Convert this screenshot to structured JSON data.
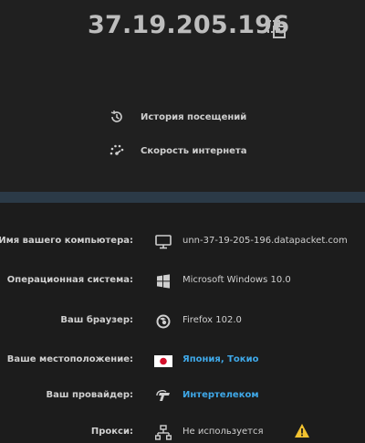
{
  "ip": {
    "address": "37.19.205.196",
    "copy_icon": "copy-icon"
  },
  "links": [
    {
      "label": "История посещений",
      "icon": "history-icon"
    },
    {
      "label": "Скорость интернета",
      "icon": "speedometer-icon"
    }
  ],
  "info": {
    "computer_name": {
      "label": "Имя вашего компьютера:",
      "value": "unn-37-19-205-196.datapacket.com",
      "icon": "monitor-icon"
    },
    "os": {
      "label": "Операционная система:",
      "value": "Microsoft Windows 10.0",
      "icon": "windows-icon"
    },
    "browser": {
      "label": "Ваш браузер:",
      "value": "Firefox 102.0",
      "icon": "firefox-icon"
    },
    "location": {
      "label": "Ваше местоположение:",
      "value": "Япония, Токио",
      "icon": "japan-flag-icon"
    },
    "provider": {
      "label": "Ваш провайдер:",
      "value": "Интертелеком",
      "icon": "intertelecom-logo-icon"
    },
    "proxy": {
      "label": "Прокси:",
      "value": "Не используется",
      "icon": "network-icon",
      "warning_icon": "warning-icon"
    }
  },
  "colors": {
    "background": "#202020",
    "info_background": "#1c1c1c",
    "divider": "#2b3a47",
    "link": "#3fa8e8",
    "warning": "#f2c230"
  }
}
